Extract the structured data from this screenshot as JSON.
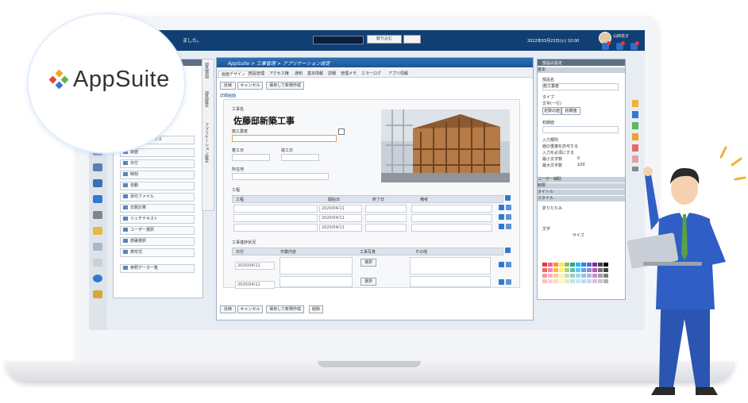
{
  "brand": {
    "logo_text": "AppSuite"
  },
  "topbar": {
    "notice": "ました。",
    "search_button": "絞り込む",
    "search_placeholder": "",
    "date_time": "2022年03月22日(火) 10:00",
    "user_name": "山田花子"
  },
  "palette": {
    "items": [
      "チェックボックス",
      "数値",
      "日付",
      "時刻",
      "自動",
      "添付ファイル",
      "日数計算",
      "リッチテキスト",
      "ユーザー選択",
      "部署選択",
      "表形式",
      "参照データ一覧"
    ]
  },
  "vtabs": [
    "部品追加",
    "部品設定",
    "アプリケーション設定"
  ],
  "main_window": {
    "breadcrumb": "AppSuite > 工事管理 > アプリケーション設定",
    "tabs": [
      "画面デザイン",
      "部品管理",
      "アクセス権",
      "通知",
      "基本情報",
      "詳細",
      "管理メモ",
      "エラーログ",
      "アプリ情報"
    ],
    "buttons": [
      "反映",
      "キャンセル",
      "保存して新規作成"
    ],
    "form_tab": "詳細画面",
    "project_label": "工事名",
    "project_name": "佐藤邸新築工事",
    "section_label": "施工業者",
    "start_label": "着工日",
    "end_label": "竣工日",
    "address_label": "所在地",
    "process_label": "工程",
    "process_columns": [
      "工程",
      "開始日",
      "終了日",
      "備考"
    ],
    "process_rows": [
      {
        "start": "2020/04/11"
      },
      {
        "start": "2020/04/11"
      },
      {
        "start": "2020/04/11"
      }
    ],
    "record_label": "工事進捗状況",
    "record_columns": [
      "日付",
      "作業内容",
      "工事写真",
      "その他"
    ],
    "record_rows": [
      {
        "date": "2020/04/11",
        "select": "選択"
      },
      {
        "date": "2020/04/11",
        "select": "選択"
      }
    ],
    "footer_buttons": [
      "反映",
      "キャンセル",
      "保存して新規作成",
      "削除"
    ]
  },
  "props": {
    "title": "部品の設定",
    "section_basic": "基本",
    "name_label": "部品名",
    "name_value": "施工業者",
    "type_label": "タイプ",
    "type_opts": [
      "文字(一行)",
      "定数の値",
      "初期値"
    ],
    "default_label": "初期値",
    "input_label": "入力規則",
    "checks": [
      "値の重複を許可する",
      "入力を必須にする"
    ],
    "min_label": "最小文字数",
    "min_value": "0",
    "max_label": "最大文字数",
    "max_value": "100",
    "sections": [
      "ユーザー補助",
      "制限",
      "タイトル",
      "スタイル"
    ],
    "wrap_label": "折りたたみ",
    "font_label": "文字",
    "size_label": "サイズ"
  },
  "colors": {
    "topbar": "#123f73",
    "accent": "#2f79d1",
    "titlebar": "#2d6fb8"
  }
}
